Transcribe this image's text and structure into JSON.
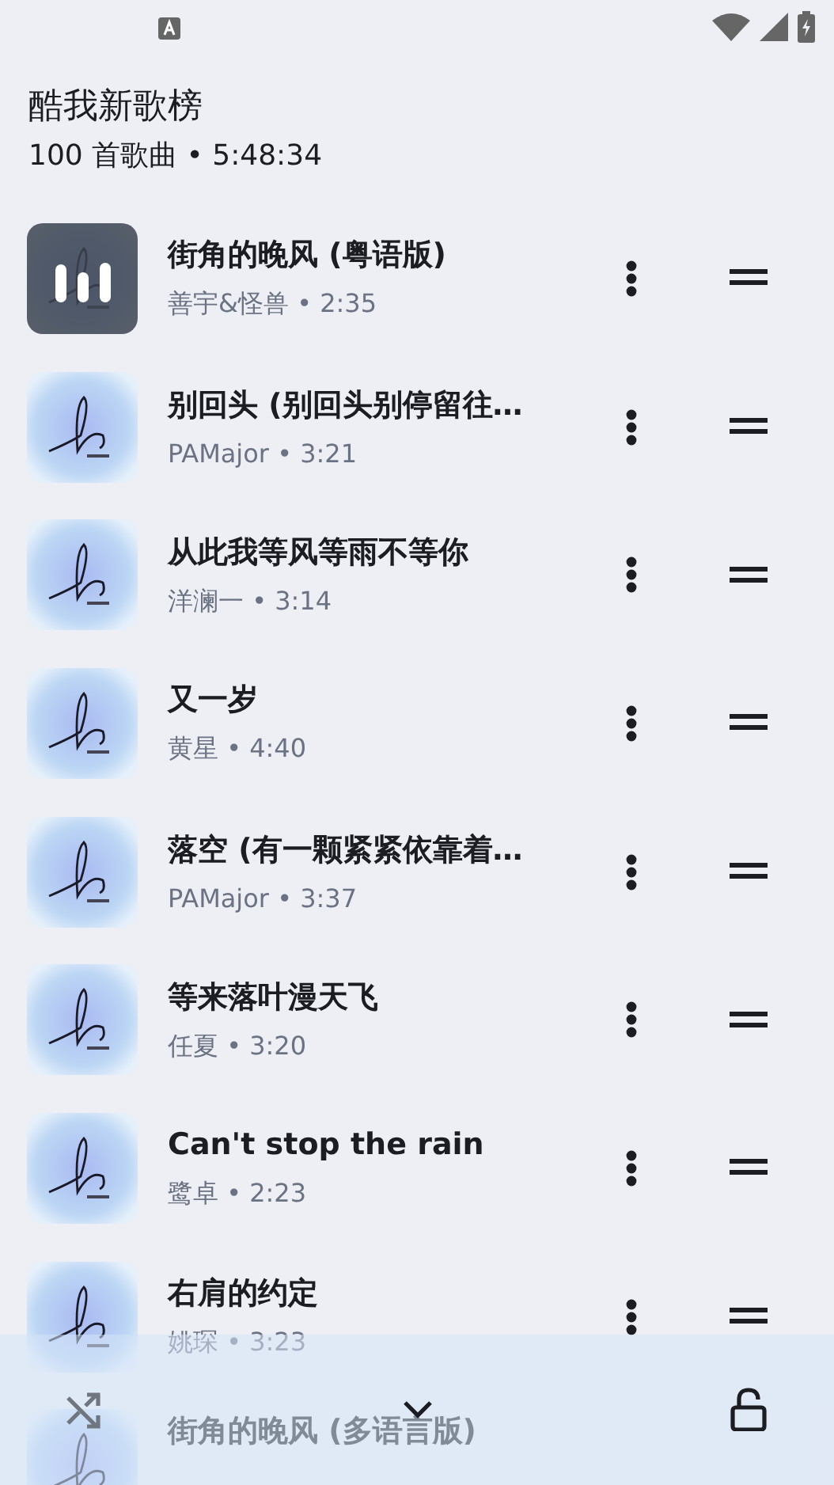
{
  "header": {
    "title": "酷我新歌榜",
    "subtitle": "100 首歌曲 • 5:48:34"
  },
  "songs": [
    {
      "title": "街角的晚风 (粤语版)",
      "meta": "善宇&怪兽 • 2:35",
      "playing": true
    },
    {
      "title": "别回头 (别回头别停留往…",
      "meta": "PAMajor • 3:21",
      "playing": false
    },
    {
      "title": "从此我等风等雨不等你",
      "meta": "洋澜一 • 3:14",
      "playing": false
    },
    {
      "title": "又一岁",
      "meta": "黄星 • 4:40",
      "playing": false
    },
    {
      "title": "落空 (有一颗紧紧依靠着…",
      "meta": "PAMajor • 3:37",
      "playing": false
    },
    {
      "title": "等来落叶漫天飞",
      "meta": "任夏 • 3:20",
      "playing": false
    },
    {
      "title": "Can't stop the rain",
      "meta": "鹭卓 • 2:23",
      "playing": false
    },
    {
      "title": "右肩的约定",
      "meta": "姚琛 • 3:23",
      "playing": false
    },
    {
      "title": "街角的晚风 (多语言版)",
      "playing": false
    }
  ]
}
